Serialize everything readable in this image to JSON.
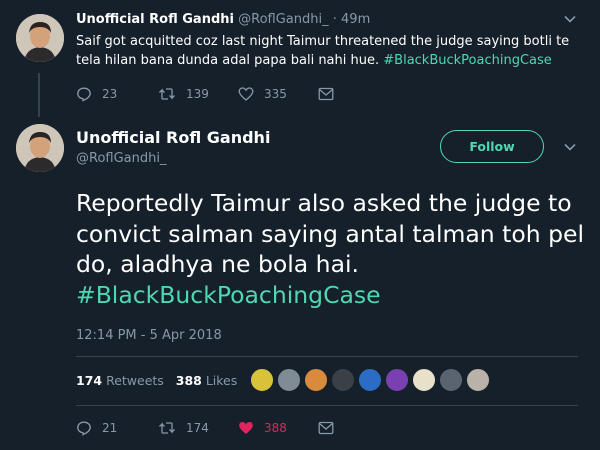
{
  "tweet1": {
    "name": "Unofficial Rofl Gandhi",
    "handle": "@RoflGandhi_",
    "separator": "·",
    "time": "49m",
    "text": "Saif got acquitted coz last night Taimur threatened the judge saying botli te tela hilan bana dunda adal papa bali nahi hue.",
    "hashtag": "#BlackBuckPoachingCase",
    "replies": "23",
    "retweets": "139",
    "likes": "335"
  },
  "tweet2": {
    "name": "Unofficial Rofl Gandhi",
    "handle": "@RoflGandhi_",
    "follow_label": "Follow",
    "text": "Reportedly Taimur also asked the judge to convict salman saying antal talman toh pel do, aladhya ne bola hai.",
    "hashtag": "#BlackBuckPoachingCase",
    "timestamp": "12:14 PM - 5 Apr 2018",
    "retweet_count": "174",
    "retweet_label": "Retweets",
    "like_count": "388",
    "like_label": "Likes",
    "replies": "21",
    "retweets": "174",
    "likes": "388"
  },
  "colors": {
    "background": "#15202b",
    "accent": "#4fd8b0",
    "muted": "#8899a6",
    "like": "#e0245e",
    "divider": "#38444d"
  },
  "likers": [
    {
      "icon": "liker-avatar",
      "color": "#d8c23a"
    },
    {
      "icon": "liker-avatar",
      "color": "#7f8c95"
    },
    {
      "icon": "liker-avatar",
      "color": "#d98a3c"
    },
    {
      "icon": "liker-avatar",
      "color": "#3a3f48"
    },
    {
      "icon": "liker-avatar",
      "color": "#2d6cc4"
    },
    {
      "icon": "liker-avatar",
      "color": "#7a3fb0"
    },
    {
      "icon": "liker-avatar",
      "color": "#e8e0c8"
    },
    {
      "icon": "liker-avatar",
      "color": "#5a6470"
    },
    {
      "icon": "liker-avatar",
      "color": "#b8b2a8"
    }
  ]
}
